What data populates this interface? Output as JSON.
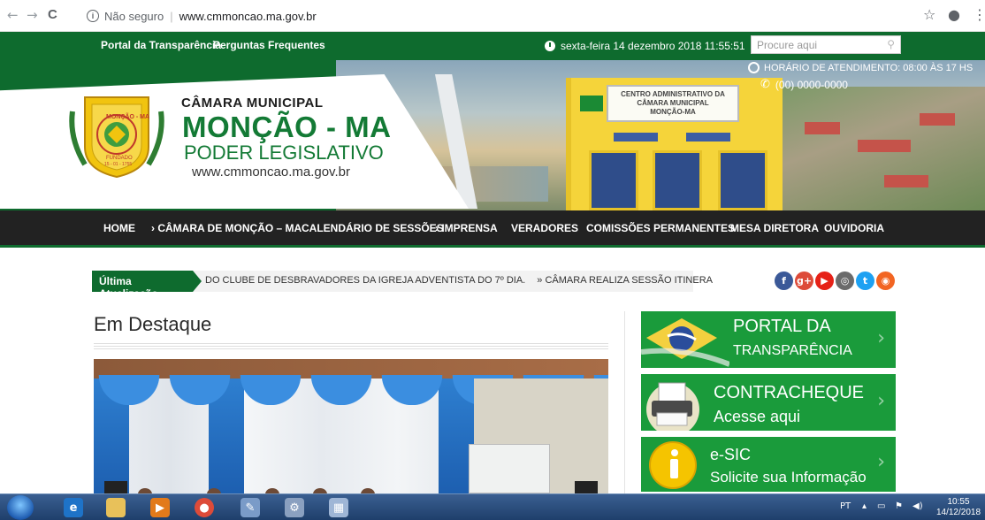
{
  "browser": {
    "back": "←",
    "forward": "→",
    "reload": "C",
    "security_label": "Não seguro",
    "url": "www.cmmoncao.ma.gov.br",
    "star": "☆",
    "account": "●",
    "menu": "⋮"
  },
  "topbar": {
    "links": [
      "Portal da Transparência",
      "Perguntas Frequentes"
    ],
    "datetime": "sexta-feira 14 dezembro 2018 11:55:51",
    "search_placeholder": "Procure aqui"
  },
  "header": {
    "line1": "CÂMARA MUNICIPAL",
    "line2": "MONÇÃO - MA",
    "line3": "PODER LEGISLATIVO",
    "line4": "www.cmmoncao.ma.gov.br",
    "crest_text": [
      "MONÇÃO - MA",
      "FUNDADO",
      "15 - 01 - 1755"
    ],
    "hours": "HORÁRIO DE ATENDIMENTO: 08:00 ÀS 17 HS",
    "phone": "(00) 0000-0000",
    "building_sign": [
      "CENTRO ADMINISTRATIVO DA",
      "CÂMARA MUNICIPAL",
      "MONÇÃO-MA"
    ]
  },
  "nav": {
    "items": [
      "HOME",
      "› CÂMARA DE MONÇÃO – MA",
      "CALENDÁRIO DE SESSÕES",
      "› IMPRENSA",
      "VERADORES",
      "COMISSÕES PERMANENTES",
      "MESA DIRETORA",
      "OUVIDORIA"
    ]
  },
  "ticker": {
    "label": "Última Atualização",
    "text": "DO CLUBE DE DESBRAVADORES DA IGREJA ADVENTISTA DO 7º DIA.",
    "text2": "» CÂMARA REALIZA SESSÃO ITINERA"
  },
  "social": [
    {
      "icon": "facebook-icon",
      "glyph": "f",
      "color": "#3b5998"
    },
    {
      "icon": "google-plus-icon",
      "glyph": "g+",
      "color": "#dd4b39"
    },
    {
      "icon": "youtube-icon",
      "glyph": "▶",
      "color": "#e62117"
    },
    {
      "icon": "instagram-icon",
      "glyph": "◎",
      "color": "#6b6b6b"
    },
    {
      "icon": "twitter-icon",
      "glyph": "t",
      "color": "#1da1f2"
    },
    {
      "icon": "rss-icon",
      "glyph": "◉",
      "color": "#f26522"
    }
  ],
  "main": {
    "section_title": "Em Destaque"
  },
  "sidebar": {
    "cards": [
      {
        "title": "PORTAL DA",
        "subtitle": "TRANSPARÊNCIA"
      },
      {
        "title": "CONTRACHEQUE",
        "subtitle": "Acesse aqui"
      },
      {
        "title": "e-SIC",
        "subtitle": "Solicite sua Informação"
      }
    ]
  },
  "taskbar": {
    "lang": "PT",
    "time": "10:55",
    "date": "14/12/2018"
  },
  "colors": {
    "brand_green": "#0e6b2e",
    "card_green": "#1a9b3b",
    "nav_dark": "#222222"
  }
}
